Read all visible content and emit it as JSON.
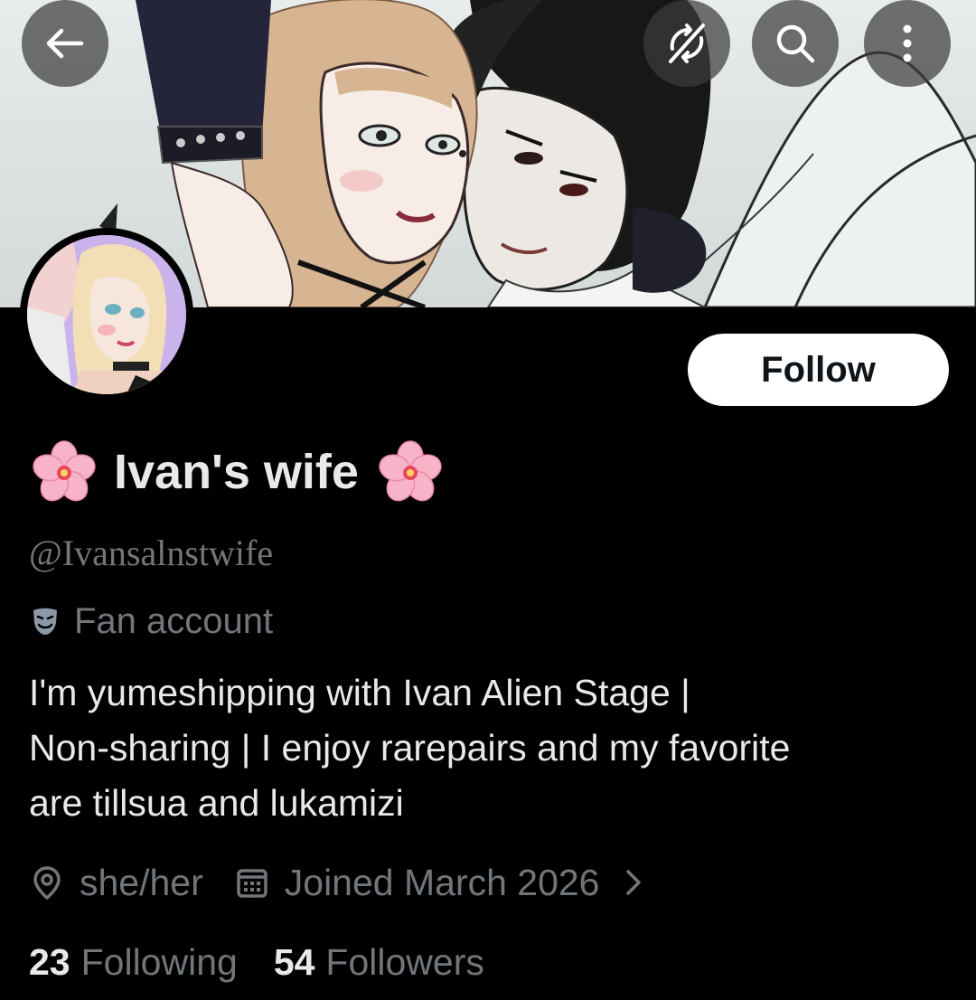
{
  "banner": {
    "alt": "header-artwork"
  },
  "nav": {
    "back_icon": "arrow-left-icon",
    "sync_icon": "sync-off-icon",
    "search_icon": "search-icon",
    "more_icon": "more-vertical-icon"
  },
  "profile": {
    "follow_label": "Follow",
    "display_name": "Ivan's wife",
    "name_emoji": "cherry-blossom-icon",
    "handle": "@Ivansalnstwife",
    "account_label": "Fan account",
    "bio_line1": "I'm yumeshipping with Ivan Alien Stage |",
    "bio_line2": "Non-sharing | I enjoy rarepairs and my favorite",
    "bio_line3": "are tillsua and lukamizi",
    "location": "she/her",
    "joined": "Joined March 2026"
  },
  "stats": {
    "following_count": "23",
    "following_label": "Following",
    "followers_count": "54",
    "followers_label": "Followers"
  },
  "colors": {
    "background": "#000000",
    "text_primary": "#e7e9ea",
    "text_secondary": "#71767b",
    "follow_bg": "#ffffff",
    "follow_text": "#0f1419"
  }
}
